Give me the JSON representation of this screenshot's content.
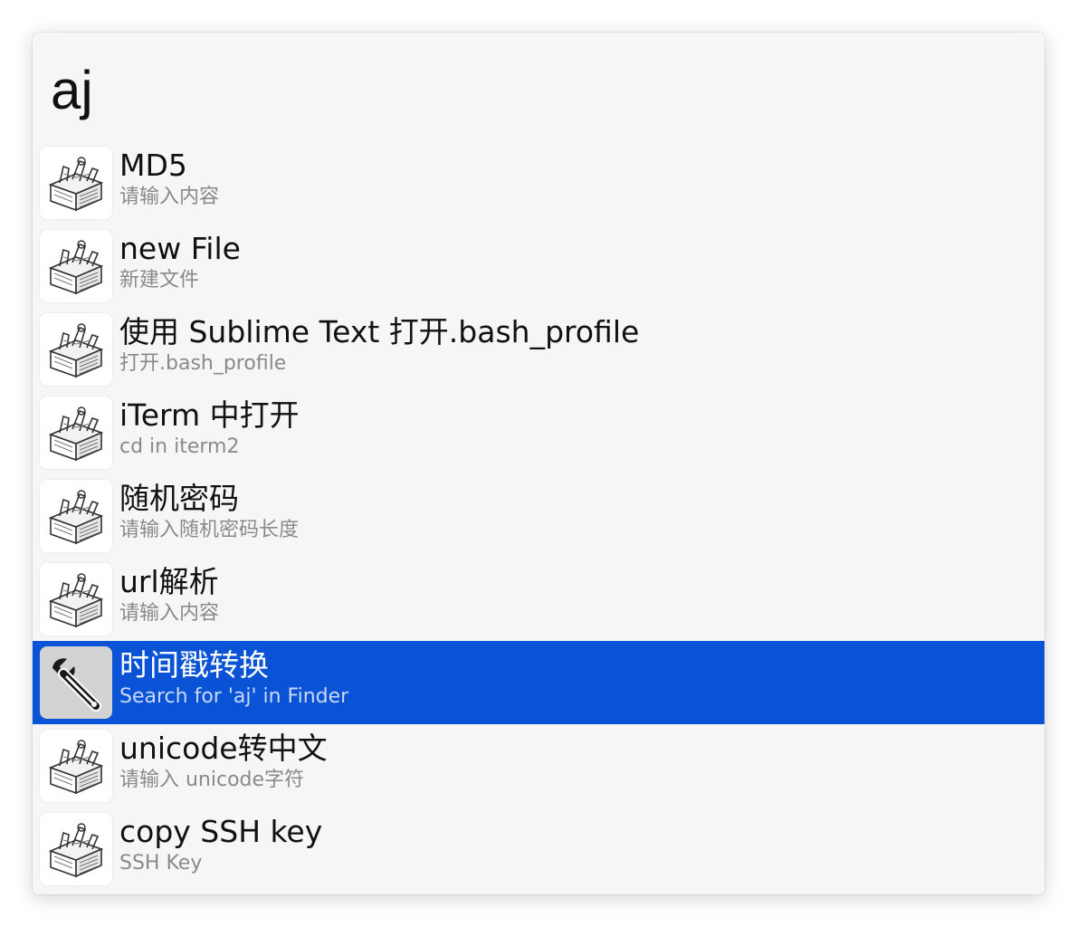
{
  "search": {
    "query": "aj"
  },
  "colors": {
    "selection": "#0b53d6",
    "panel_background": "#f6f6f6",
    "title_text": "#111111",
    "subtitle_text": "#8a8a8a"
  },
  "results": [
    {
      "title": "MD5",
      "subtitle": "请输入内容",
      "icon": "toolbox-icon",
      "selected": false
    },
    {
      "title": "new File",
      "subtitle": "新建文件",
      "icon": "toolbox-icon",
      "selected": false
    },
    {
      "title": "使用 Sublime Text 打开.bash_profile",
      "subtitle": "打开.bash_profile",
      "icon": "toolbox-icon",
      "selected": false
    },
    {
      "title": "iTerm 中打开",
      "subtitle": "cd in iterm2",
      "icon": "toolbox-icon",
      "selected": false
    },
    {
      "title": "随机密码",
      "subtitle": "请输入随机密码长度",
      "icon": "toolbox-icon",
      "selected": false
    },
    {
      "title": "url解析",
      "subtitle": "请输入内容",
      "icon": "toolbox-icon",
      "selected": false
    },
    {
      "title": "时间戳转换",
      "subtitle": "Search for 'aj' in Finder",
      "icon": "wrench-icon",
      "selected": true
    },
    {
      "title": "unicode转中文",
      "subtitle": "请输入 unicode字符",
      "icon": "toolbox-icon",
      "selected": false
    },
    {
      "title": "copy SSH key",
      "subtitle": "SSH Key",
      "icon": "toolbox-icon",
      "selected": false
    }
  ]
}
